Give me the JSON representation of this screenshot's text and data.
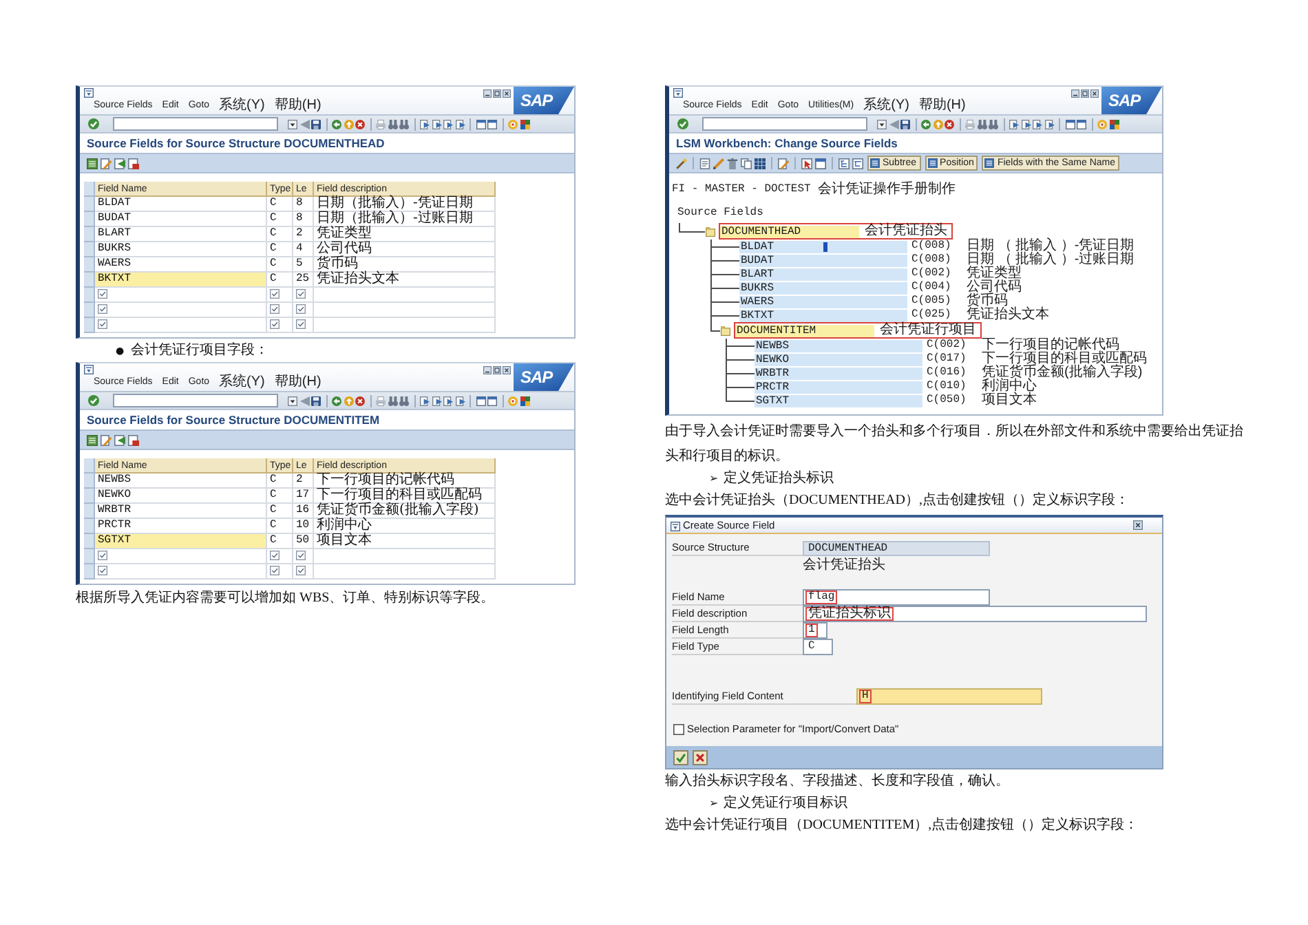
{
  "left_column": [
    {
      "kind": "table_window",
      "menu": [
        "Source Fields",
        "Edit",
        "Goto",
        "系统(Y)",
        "帮助(H)"
      ],
      "logo": "SAP",
      "title": "Source Fields for Source Structure DOCUMENTHEAD",
      "columns": [
        "Field Name",
        "Type",
        "Le",
        "Field description"
      ],
      "rows": [
        {
          "kind": "entry",
          "cells": [
            "BLDAT",
            "C",
            "8",
            "日期（批输入）-凭证日期"
          ],
          "selected": false
        },
        {
          "kind": "entry",
          "cells": [
            "BUDAT",
            "C",
            "8",
            "日期（批输入）-过账日期"
          ],
          "selected": false
        },
        {
          "kind": "entry",
          "cells": [
            "BLART",
            "C",
            "2",
            "凭证类型"
          ],
          "selected": false
        },
        {
          "kind": "entry",
          "cells": [
            "BUKRS",
            "C",
            "4",
            "公司代码"
          ],
          "selected": false
        },
        {
          "kind": "entry",
          "cells": [
            "WAERS",
            "C",
            "5",
            "货币码"
          ],
          "selected": false
        },
        {
          "kind": "entry",
          "cells": [
            "BKTXT",
            "C",
            "25",
            "凭证抬头文本"
          ],
          "selected": true
        },
        {
          "kind": "blank",
          "selected": false
        },
        {
          "kind": "blank",
          "selected": false
        },
        {
          "kind": "blank",
          "selected": false
        }
      ]
    },
    {
      "kind": "bullet",
      "marker": "●",
      "text": "会计凭证行项目字段："
    },
    {
      "kind": "table_window",
      "menu": [
        "Source Fields",
        "Edit",
        "Goto",
        "系统(Y)",
        "帮助(H)"
      ],
      "logo": "SAP",
      "title": "Source Fields for Source Structure DOCUMENTITEM",
      "columns": [
        "Field Name",
        "Type",
        "Le",
        "Field description"
      ],
      "rows": [
        {
          "kind": "entry",
          "cells": [
            "NEWBS",
            "C",
            "2",
            "下一行项目的记帐代码"
          ],
          "selected": false
        },
        {
          "kind": "entry",
          "cells": [
            "NEWKO",
            "C",
            "17",
            "下一行项目的科目或匹配码"
          ],
          "selected": false
        },
        {
          "kind": "entry",
          "cells": [
            "WRBTR",
            "C",
            "16",
            "凭证货币金额(批输入字段)"
          ],
          "selected": false
        },
        {
          "kind": "entry",
          "cells": [
            "PRCTR",
            "C",
            "10",
            "利润中心"
          ],
          "selected": false
        },
        {
          "kind": "entry",
          "cells": [
            "SGTXT",
            "C",
            "50",
            "项目文本"
          ],
          "selected": true
        },
        {
          "kind": "blank",
          "selected": false
        },
        {
          "kind": "blank",
          "selected": false
        }
      ]
    },
    {
      "kind": "paragraph",
      "text": "根据所导入凭证内容需要可以增加如 WBS、订单、特别标识等字段。"
    }
  ],
  "right_column": [
    {
      "kind": "tree_window",
      "menu": [
        "Source Fields",
        "Edit",
        "Goto",
        "Utilities(M)",
        "系统(Y)",
        "帮助(H)"
      ],
      "logo": "SAP",
      "title": "LSM Workbench: Change Source Fields",
      "buttons": [
        "Subtree",
        "Position",
        "Fields with the Same Name"
      ],
      "path": "FI - MASTER - DOCTEST",
      "path_description": "会计凭证操作手册制作",
      "tree_label": "Source Fields",
      "tree": [
        {
          "kind": "structure",
          "name": "DOCUMENTHEAD",
          "description": "会计凭证抬头",
          "highlighted": true,
          "cursor": false,
          "children": [
            {
              "kind": "field",
              "name": "BLDAT",
              "type": "C(008)",
              "description": "日期 （ 批输入 ）-凭证日期",
              "cursor": true
            },
            {
              "kind": "field",
              "name": "BUDAT",
              "type": "C(008)",
              "description": "日期 （ 批输入 ）-过账日期",
              "cursor": false
            },
            {
              "kind": "field",
              "name": "BLART",
              "type": "C(002)",
              "description": "凭证类型",
              "cursor": false
            },
            {
              "kind": "field",
              "name": "BUKRS",
              "type": "C(004)",
              "description": "公司代码",
              "cursor": false
            },
            {
              "kind": "field",
              "name": "WAERS",
              "type": "C(005)",
              "description": "货币码",
              "cursor": false
            },
            {
              "kind": "field",
              "name": "BKTXT",
              "type": "C(025)",
              "description": "凭证抬头文本",
              "cursor": false
            },
            {
              "kind": "structure",
              "name": "DOCUMENTITEM",
              "description": "会计凭证行项目",
              "highlighted": true,
              "cursor": false,
              "children": [
                {
                  "kind": "field",
                  "name": "NEWBS",
                  "type": "C(002)",
                  "description": "下一行项目的记帐代码",
                  "cursor": false
                },
                {
                  "kind": "field",
                  "name": "NEWKO",
                  "type": "C(017)",
                  "description": "下一行项目的科目或匹配码",
                  "cursor": false
                },
                {
                  "kind": "field",
                  "name": "WRBTR",
                  "type": "C(016)",
                  "description": "凭证货币金额(批输入字段)",
                  "cursor": false
                },
                {
                  "kind": "field",
                  "name": "PRCTR",
                  "type": "C(010)",
                  "description": "利润中心",
                  "cursor": false
                },
                {
                  "kind": "field",
                  "name": "SGTXT",
                  "type": "C(050)",
                  "description": "项目文本",
                  "cursor": false
                }
              ]
            }
          ]
        }
      ]
    },
    {
      "kind": "paragraph",
      "text": "由于导入会计凭证时需要导入一个抬头和多个行项目．所以在外部文件和系统中需要给出凭证抬头和行项目的标识。"
    },
    {
      "kind": "arrow_item",
      "marker": "➢",
      "text": "定义凭证抬头标识"
    },
    {
      "kind": "paragraph",
      "text": "选中会计凭证抬头（DOCUMENTHEAD）,点击创建按钮（）定义标识字段："
    },
    {
      "kind": "dialog",
      "title": "Create Source Field",
      "structure": {
        "label": "Source Structure",
        "value": "DOCUMENTHEAD",
        "note": "会计凭证抬头"
      },
      "fields": [
        {
          "label": "Field Name",
          "value": "flag",
          "highlighted": true
        },
        {
          "label": "Field description",
          "value": "凭证抬头标识",
          "highlighted": true
        },
        {
          "label": "Field Length",
          "value": "1",
          "highlighted": true
        },
        {
          "label": "Field Type",
          "value": "C",
          "highlighted": false
        }
      ],
      "key_field": {
        "label": "Identifying Field Content",
        "value": "H",
        "highlighted": true
      },
      "checkbox": {
        "label": "Selection Parameter for \"Import/Convert Data\"",
        "checked": false
      }
    },
    {
      "kind": "paragraph",
      "text": "输入抬头标识字段名、字段描述、长度和字段值，确认。"
    },
    {
      "kind": "arrow_item",
      "marker": "➢",
      "text": "定义凭证行项目标识"
    },
    {
      "kind": "paragraph",
      "text": "选中会计凭证行项目（DOCUMENTITEM）,点击创建按钮（）定义标识字段："
    }
  ]
}
